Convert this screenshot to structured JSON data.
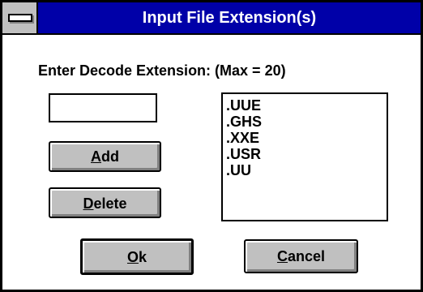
{
  "window": {
    "title": "Input File Extension(s)"
  },
  "prompt_label": "Enter Decode Extension: (Max = 20)",
  "extension_input": {
    "value": ""
  },
  "extension_list": {
    "items": [
      ".UUE",
      ".GHS",
      ".XXE",
      ".USR",
      ".UU"
    ]
  },
  "buttons": {
    "add": {
      "accel": "A",
      "rest": "dd"
    },
    "delete": {
      "accel": "D",
      "rest": "elete"
    },
    "ok": {
      "accel": "O",
      "rest": "k"
    },
    "cancel": {
      "accel": "C",
      "rest": "ancel"
    }
  },
  "colors": {
    "titlebar": "#0000a8",
    "button_face": "#c0c0c0"
  },
  "icons": {
    "system_menu": "system-menu-icon"
  }
}
